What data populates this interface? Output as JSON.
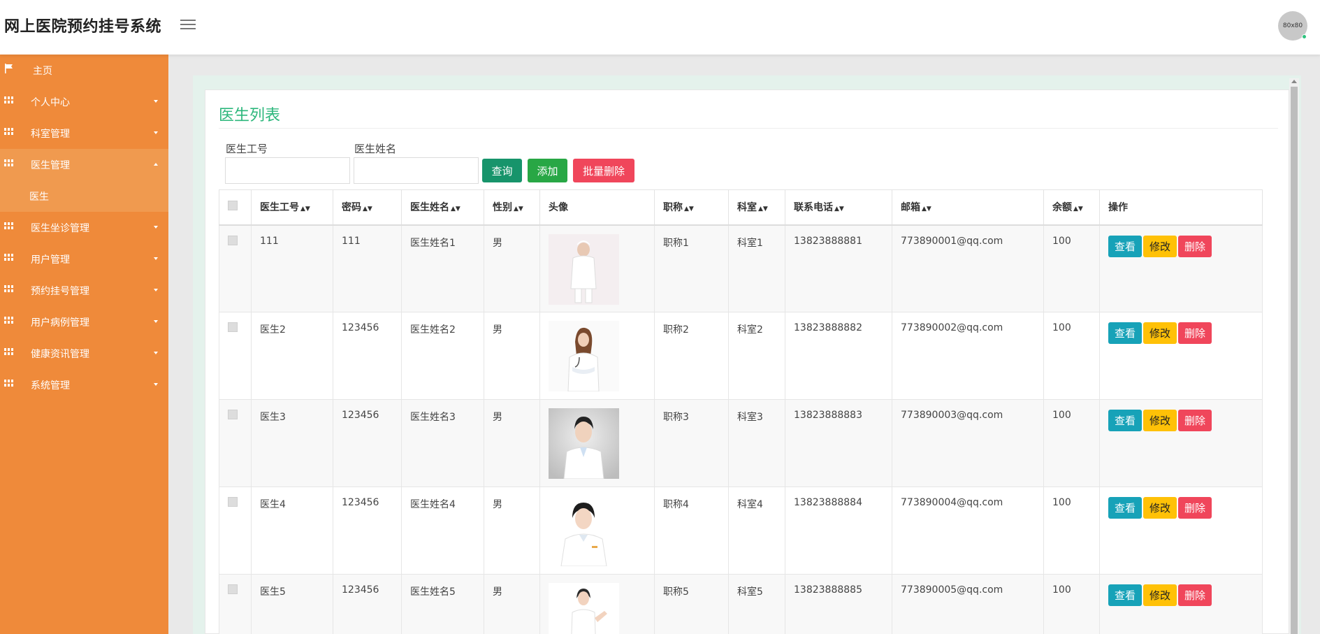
{
  "header": {
    "title": "网上医院预约挂号系统",
    "avatar_text": "80x80"
  },
  "sidebar": {
    "items": [
      {
        "label": "主页"
      },
      {
        "label": "个人中心"
      },
      {
        "label": "科室管理"
      },
      {
        "label": "医生管理"
      },
      {
        "label": "医生"
      },
      {
        "label": "医生坐诊管理"
      },
      {
        "label": "用户管理"
      },
      {
        "label": "预约挂号管理"
      },
      {
        "label": "用户病例管理"
      },
      {
        "label": "健康资讯管理"
      },
      {
        "label": "系统管理"
      }
    ]
  },
  "main": {
    "title": "医生列表",
    "search": {
      "id_label": "医生工号",
      "id_value": "",
      "id_placeholder": "",
      "name_label": "医生姓名",
      "name_value": "",
      "name_placeholder": ""
    },
    "buttons": {
      "query": "查询",
      "add": "添加",
      "batch_delete": "批量删除"
    },
    "columns": {
      "id": "医生工号",
      "password": "密码",
      "name": "医生姓名",
      "gender": "性别",
      "avatar": "头像",
      "title": "职称",
      "dept": "科室",
      "phone": "联系电话",
      "email": "邮箱",
      "balance": "余额",
      "actions": "操作"
    },
    "actions": {
      "view": "查看",
      "edit": "修改",
      "delete": "删除"
    },
    "rows": [
      {
        "id": "111",
        "password": "111",
        "name": "医生姓名1",
        "gender": "男",
        "title": "职称1",
        "dept": "科室1",
        "phone": "13823888881",
        "email": "773890001@qq.com",
        "balance": "100"
      },
      {
        "id": "医生2",
        "password": "123456",
        "name": "医生姓名2",
        "gender": "男",
        "title": "职称2",
        "dept": "科室2",
        "phone": "13823888882",
        "email": "773890002@qq.com",
        "balance": "100"
      },
      {
        "id": "医生3",
        "password": "123456",
        "name": "医生姓名3",
        "gender": "男",
        "title": "职称3",
        "dept": "科室3",
        "phone": "13823888883",
        "email": "773890003@qq.com",
        "balance": "100"
      },
      {
        "id": "医生4",
        "password": "123456",
        "name": "医生姓名4",
        "gender": "男",
        "title": "职称4",
        "dept": "科室4",
        "phone": "13823888884",
        "email": "773890004@qq.com",
        "balance": "100"
      },
      {
        "id": "医生5",
        "password": "123456",
        "name": "医生姓名5",
        "gender": "男",
        "title": "职称5",
        "dept": "科室5",
        "phone": "13823888885",
        "email": "773890005@qq.com",
        "balance": "100"
      }
    ]
  },
  "colors": {
    "sidebar": "#ef8a3a",
    "sidebar_active": "#f09a4f",
    "title_green": "#2db77c",
    "query_btn": "#17946b",
    "add_btn": "#28a745",
    "batch_delete_btn": "#f0465b",
    "view_btn": "#17a2b8",
    "edit_btn": "#ffc107",
    "delete_btn": "#f0465b"
  }
}
